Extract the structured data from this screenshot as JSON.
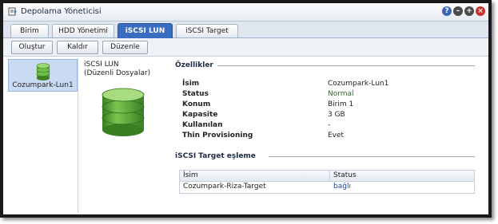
{
  "window": {
    "title": "Depolama Yöneticisi"
  },
  "title_controls": {
    "help": "?",
    "minimize": "–",
    "maximize": "+",
    "close": "×"
  },
  "tabs": [
    {
      "label": "Birim"
    },
    {
      "label": "HDD Yönetimi"
    },
    {
      "label": "iSCSI LUN"
    },
    {
      "label": "iSCSI Target"
    }
  ],
  "toolbar": {
    "create": "Oluştur",
    "remove": "Kaldır",
    "edit": "Düzenle"
  },
  "sidebar": {
    "items": [
      {
        "label": "Cozumpark-Lun1"
      }
    ]
  },
  "detail": {
    "lun_title": "iSCSI LUN",
    "lun_subtitle": "(Düzenli Dosyalar)",
    "properties_heading": "Özellikler",
    "properties": [
      {
        "label": "İsim",
        "value": "Cozumpark-Lun1"
      },
      {
        "label": "Status",
        "value": "Normal"
      },
      {
        "label": "Konum",
        "value": "Birim 1"
      },
      {
        "label": "Kapasite",
        "value": "3 GB"
      },
      {
        "label": "Kullanılan",
        "value": "-"
      },
      {
        "label": "Thin Provisioning",
        "value": "Evet"
      }
    ],
    "mapping_heading": "iSCSI Target eşleme",
    "mapping_table": {
      "columns": [
        "İsim",
        "Status"
      ],
      "rows": [
        {
          "name": "Cozumpark-Riza-Target",
          "status": "bağlı"
        }
      ]
    }
  },
  "colors": {
    "active_tab": "#3a6cc1",
    "status_normal": "#2a6d2a",
    "link_blue": "#1a3fa8",
    "db_green": "#5aa83a"
  },
  "icons": {
    "app": "storage-manager-icon",
    "lun": "database-icon"
  }
}
